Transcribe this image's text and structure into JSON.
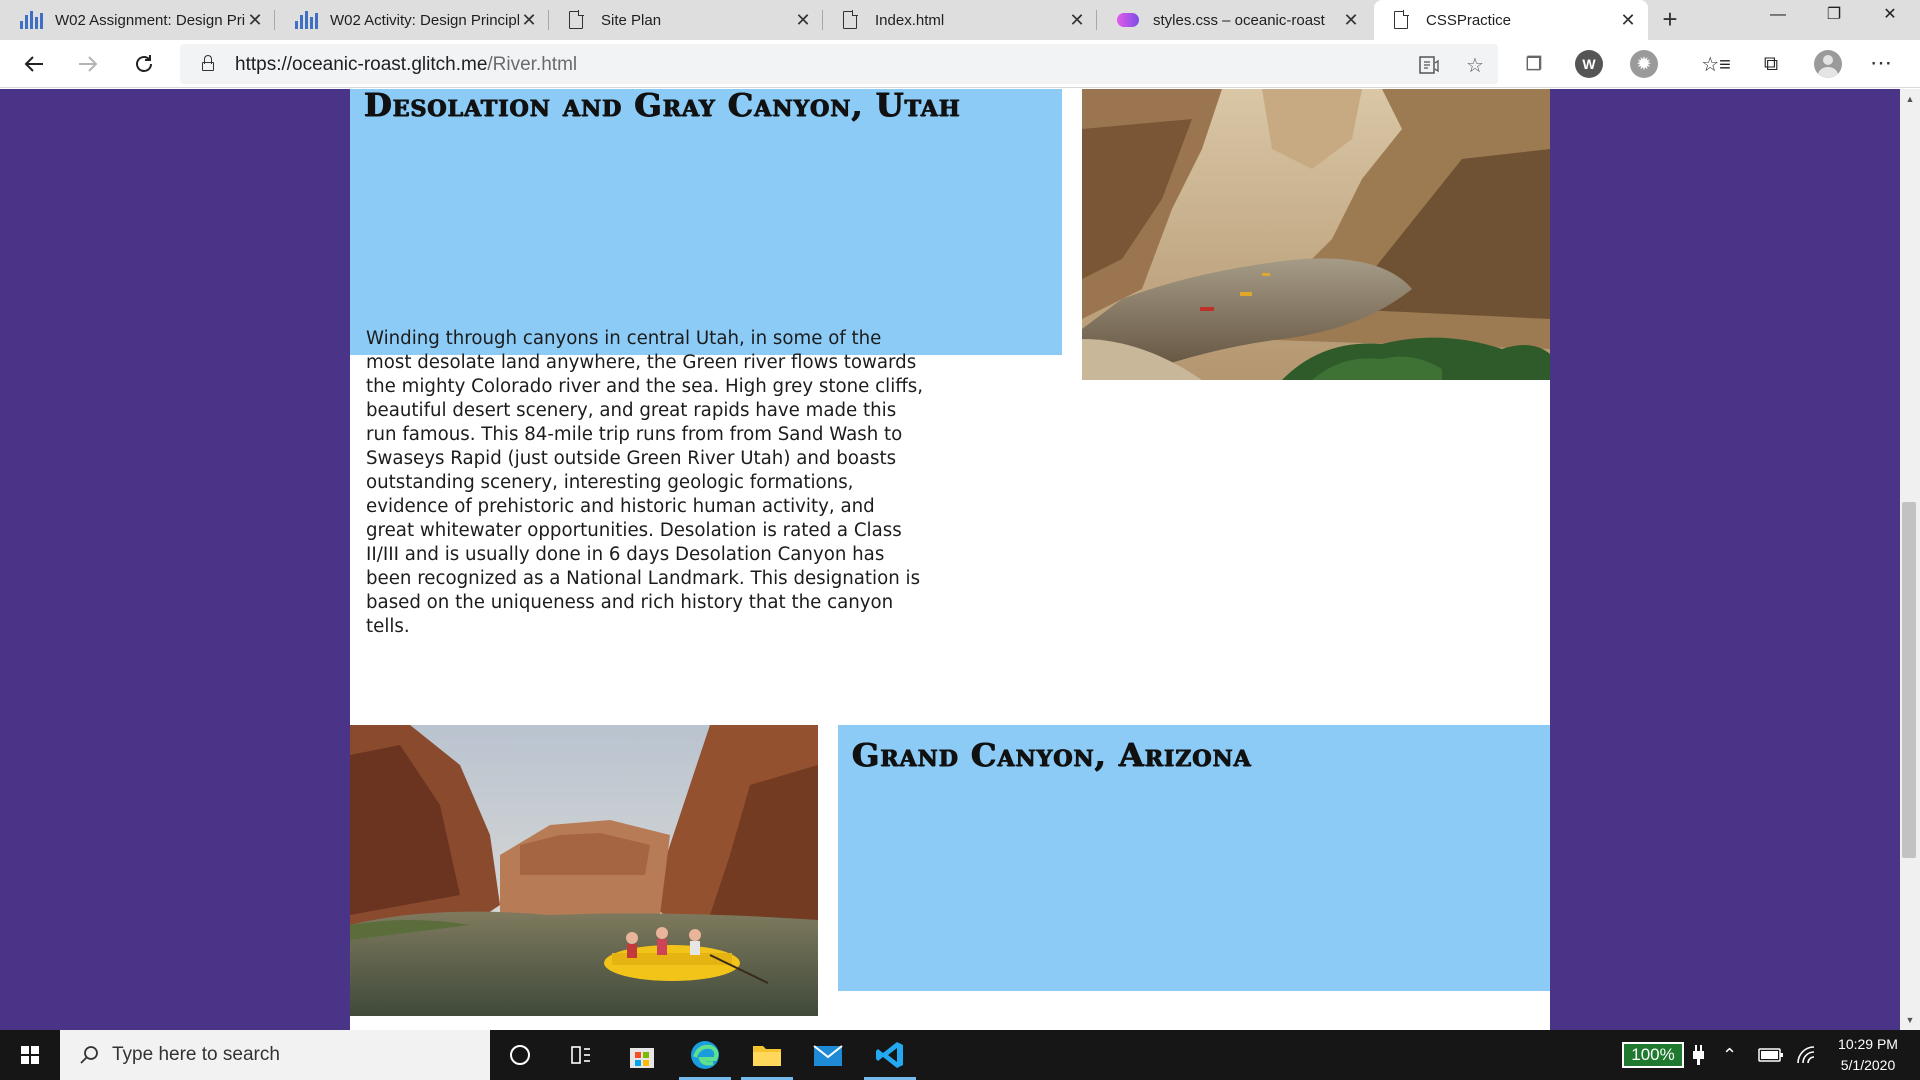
{
  "browser": {
    "tabs": [
      {
        "title": "W02 Assignment: Design Pri",
        "icon": "canvas-chart-icon",
        "active": false
      },
      {
        "title": "W02 Activity: Design Principl",
        "icon": "canvas-chart-icon",
        "active": false
      },
      {
        "title": "Site Plan",
        "icon": "document-icon",
        "active": false
      },
      {
        "title": "Index.html",
        "icon": "document-icon",
        "active": false
      },
      {
        "title": "styles.css – oceanic-roast",
        "icon": "glitch-icon",
        "active": false
      },
      {
        "title": "CSSPractice",
        "icon": "document-icon",
        "active": true
      }
    ],
    "url_host": "https://oceanic-roast.glitch.me",
    "url_path": "/River.html"
  },
  "page": {
    "section1": {
      "heading": "Desolation and Gray Canyon, Utah",
      "paragraph": "Winding through canyons in central Utah, in some of the most desolate land anywhere, the Green river flows towards the mighty Colorado river and the sea. High grey stone cliffs, beautiful desert scenery, and great rapids have made this run famous. This 84-mile trip runs from from Sand Wash to Swaseys Rapid (just outside Green River Utah) and boasts outstanding scenery, interesting geologic formations, evidence of prehistoric and historic human activity, and great whitewater opportunities. Desolation is rated a Class II/III and is usually done in 6 days Desolation Canyon has been recognized as a National Landmark. This designation is based on the uniqueness and rich history that the canyon tells.",
      "image": "river-canyon-rafts-photo"
    },
    "section2": {
      "heading": "Grand Canyon, Arizona",
      "image": "grand-canyon-raft-photo"
    }
  },
  "taskbar": {
    "search_placeholder": "Type here to search",
    "battery": "100%",
    "time": "10:29 PM",
    "date": "5/1/2020"
  },
  "colors": {
    "page_background": "#4a3488",
    "heading_box": "#8ccbf6",
    "content": "#ffffff"
  }
}
